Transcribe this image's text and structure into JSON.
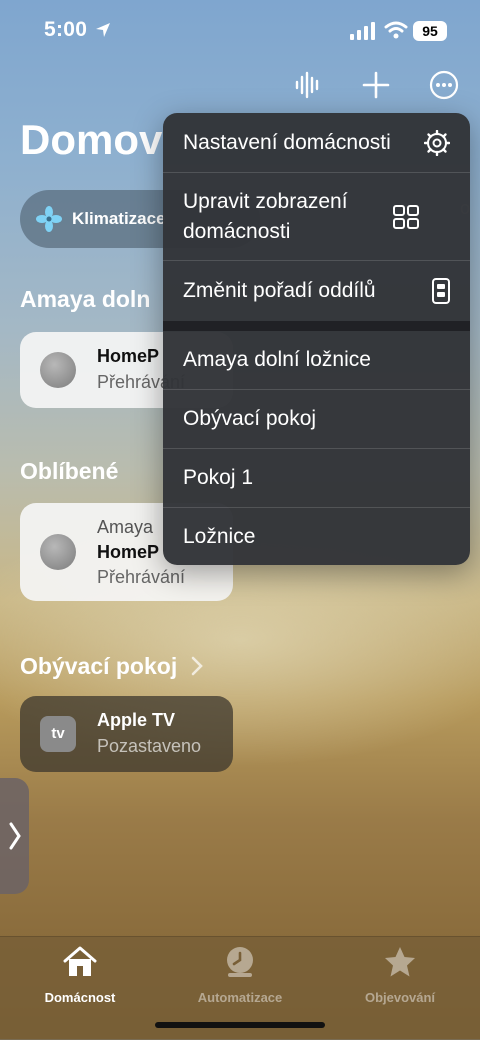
{
  "status_bar": {
    "time": "5:00",
    "battery": "95"
  },
  "page": {
    "title": "Domov"
  },
  "pill": {
    "label": "Klimatizace"
  },
  "sections": [
    {
      "title": "Amaya doln"
    },
    {
      "title": "Oblíbené"
    },
    {
      "title": "Obývací pokoj"
    }
  ],
  "tiles": [
    {
      "title": "HomeP",
      "status": "Přehrávání"
    },
    {
      "room": "Amaya",
      "title": "HomeP",
      "status": "Přehrávání"
    },
    {
      "icon_text": "tv",
      "title": "Apple TV",
      "status": "Pozastaveno"
    }
  ],
  "menu": {
    "items": [
      {
        "label": "Nastavení domácnosti",
        "icon": "gear-icon"
      },
      {
        "label": "Upravit zobrazení domácnosti",
        "icon": "grid-icon"
      },
      {
        "label": "Změnit pořadí oddílů",
        "icon": "reorder-icon"
      },
      {
        "label": "Amaya dolní ložnice"
      },
      {
        "label": "Obývací pokoj"
      },
      {
        "label": "Pokoj 1"
      },
      {
        "label": "Ložnice"
      }
    ]
  },
  "tabs": [
    {
      "label": "Domácnost",
      "icon": "house-icon",
      "active": true
    },
    {
      "label": "Automatizace",
      "icon": "clock-icon",
      "active": false
    },
    {
      "label": "Objevování",
      "icon": "star-icon",
      "active": false
    }
  ],
  "colors": {
    "menu_bg": "#323438",
    "tile_bg": "#f5f5f5",
    "tabbar_bg": "#785f37"
  }
}
